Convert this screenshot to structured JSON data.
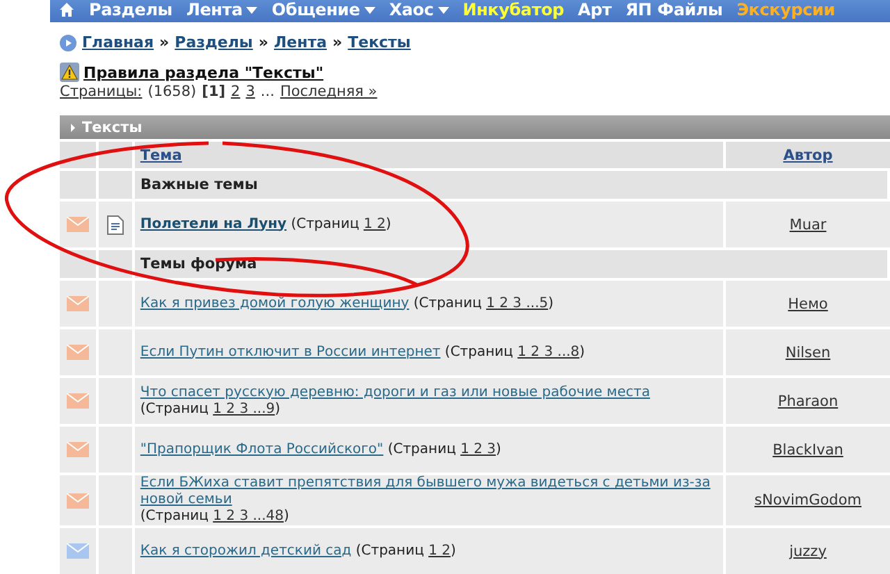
{
  "nav": [
    {
      "label": "Разделы",
      "color": "#ffffff",
      "has_menu": false
    },
    {
      "label": "Лента",
      "color": "#ffffff",
      "has_menu": true
    },
    {
      "label": "Общение",
      "color": "#ffffff",
      "has_menu": true
    },
    {
      "label": "Хаос",
      "color": "#ffffff",
      "has_menu": true
    },
    {
      "label": "Инкубатор",
      "color": "#ffff33",
      "has_menu": false
    },
    {
      "label": "Арт",
      "color": "#ffffff",
      "has_menu": false
    },
    {
      "label": "ЯП Файлы",
      "color": "#ffffff",
      "has_menu": false
    },
    {
      "label": "Экскурсии",
      "color": "#ffb020",
      "has_menu": false
    }
  ],
  "breadcrumb": [
    {
      "label": "Главная"
    },
    {
      "sep": "»",
      "label": "Разделы"
    },
    {
      "sep": "»",
      "label": "Лента"
    },
    {
      "sep": "»",
      "label": "Тексты"
    }
  ],
  "rules_link": "Правила раздела \"Тексты\"",
  "pager": {
    "label": "Страницы:",
    "count": "(1658)",
    "current": "[1]",
    "pages": [
      "2",
      "3"
    ],
    "ellipsis": "...",
    "last": "Последняя »"
  },
  "forum": {
    "title": "Тексты",
    "columns": [
      "Тема",
      "Автор"
    ],
    "sections": [
      {
        "title": "Важные темы",
        "topics": [
          {
            "title": "Полетели на Луну",
            "kind": "pinned",
            "color": "#f5b898",
            "pages_label": "(Страниц",
            "pages": "1 2",
            "close": ")",
            "author": "Muar"
          }
        ]
      },
      {
        "title": "Темы форума",
        "topics": [
          {
            "title": "Как я привез домой голую женщину",
            "kind": "normal",
            "color": "#f5b898",
            "pages_label": "(Страниц",
            "pages": "1 2 3 ...5",
            "close": ")",
            "author": "Немо"
          },
          {
            "title": "Если Путин отключит в России интернет",
            "kind": "normal",
            "color": "#f5b898",
            "pages_label": "(Страниц",
            "pages": "1 2 3 ...8",
            "close": ")",
            "author": "Nilsen"
          },
          {
            "title": "Что спасет русскую деревню: дороги и газ или новые рабочие места",
            "kind": "normal",
            "color": "#f5b898",
            "pages_label": "(Страниц",
            "pages": "1 2 3 ...9",
            "close": ")",
            "author": "Pharaon"
          },
          {
            "title": "\"Прапорщик Флота Российского\"",
            "kind": "normal",
            "color": "#f5b898",
            "pages_label": "(Страниц",
            "pages": "1 2 3",
            "close": ")",
            "author": "BlackIvan"
          },
          {
            "title": "Если БЖиха ставит препятствия для бывшего мужа видеться с детьми из-за новой семьи",
            "kind": "normal",
            "color": "#f5b898",
            "pages_label": "(Страниц",
            "pages": "1 2 3 ...48",
            "close": ")",
            "author": "sNovimGodom"
          },
          {
            "title": "Как я сторожил детский сад",
            "kind": "normal",
            "color": "#a9c6f0",
            "pages_label": "(Страниц",
            "pages": "1 2",
            "close": ")",
            "author": "juzzy"
          }
        ]
      }
    ]
  }
}
